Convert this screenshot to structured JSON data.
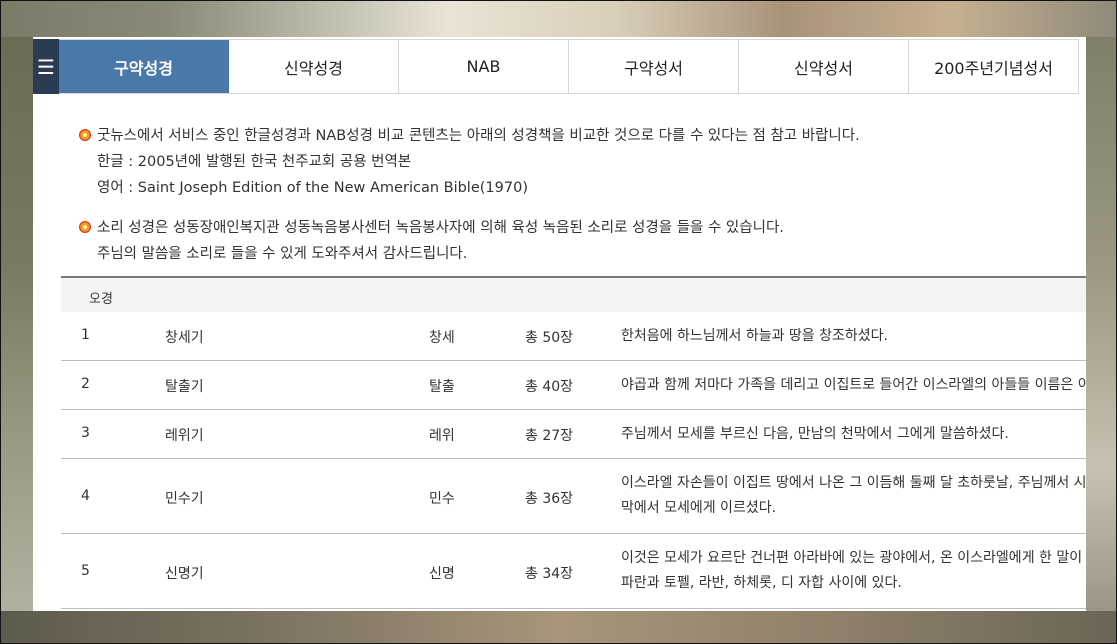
{
  "menu_icon": "menu-icon",
  "tabs": [
    {
      "label": "구약성경",
      "active": true
    },
    {
      "label": "신약성경",
      "active": false
    },
    {
      "label": "NAB",
      "active": false
    },
    {
      "label": "구약성서",
      "active": false
    },
    {
      "label": "신약성서",
      "active": false
    },
    {
      "label": "200주년기념성서",
      "active": false
    }
  ],
  "notes": [
    {
      "lines": [
        "굿뉴스에서 서비스 중인 한글성경과 NAB성경 비교 콘텐츠는 아래의 성경책을 비교한 것으로 다를 수 있다는 점 참고 바랍니다.",
        "한글 : 2005년에 발행된 한국 천주교회 공용 번역본",
        "영어 : Saint Joseph Edition of the New American Bible(1970)"
      ]
    },
    {
      "lines": [
        "소리 성경은 성동장애인복지관 성동녹음봉사센터 녹음봉사자에 의해 육성 녹음된 소리로 성경을 들을 수 있습니다.",
        "주님의 말씀을 소리로 들을 수 있게 도와주셔서 감사드립니다."
      ]
    }
  ],
  "section_title": "오경",
  "books": [
    {
      "num": "1",
      "name": "창세기",
      "abbr": "창세",
      "chapters": "총 50장",
      "desc": [
        "한처음에 하느님께서 하늘과 땅을 창조하셨다."
      ]
    },
    {
      "num": "2",
      "name": "탈출기",
      "abbr": "탈출",
      "chapters": "총 40장",
      "desc": [
        "야곱과 함께 저마다 가족을 데리고 이집트로 들어간 이스라엘의 아들들 이름은 이"
      ]
    },
    {
      "num": "3",
      "name": "레위기",
      "abbr": "레위",
      "chapters": "총 27장",
      "desc": [
        "주님께서 모세를 부르신 다음, 만남의 천막에서 그에게 말씀하셨다."
      ]
    },
    {
      "num": "4",
      "name": "민수기",
      "abbr": "민수",
      "chapters": "총 36장",
      "desc": [
        "이스라엘 자손들이 이집트 땅에서 나온 그 이듬해 둘째 달 초하룻날, 주님께서 시",
        "막에서 모세에게 이르셨다."
      ]
    },
    {
      "num": "5",
      "name": "신명기",
      "abbr": "신명",
      "chapters": "총 34장",
      "desc": [
        "이것은 모세가 요르단 건너편 아라바에 있는 광야에서, 온 이스라엘에게 한 말이",
        "파란과 토펠, 라반, 하체롯, 디 자합 사이에 있다."
      ]
    }
  ]
}
